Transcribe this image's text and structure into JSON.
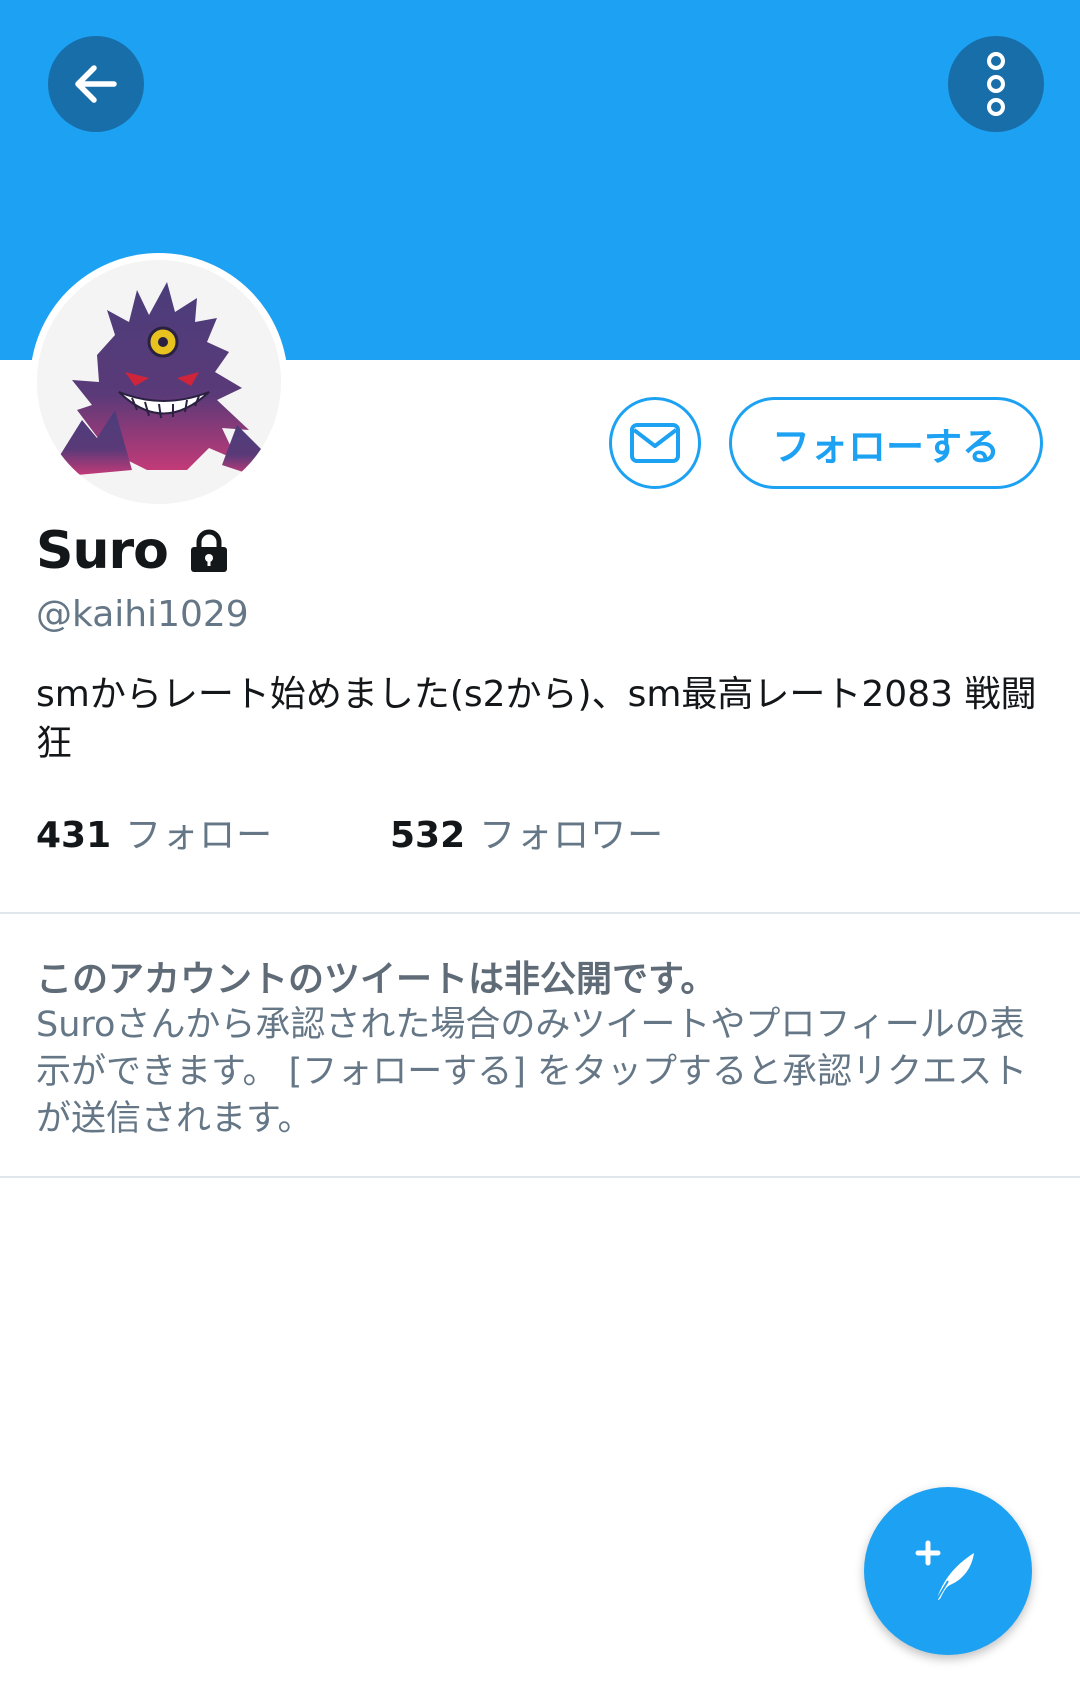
{
  "header": {
    "back_icon": "arrow-left-icon",
    "more_icon": "more-vertical-icon",
    "banner_color": "#1da1f2"
  },
  "profile": {
    "avatar_icon": "gengar-avatar",
    "name": "Suro",
    "protected_icon": "lock-icon",
    "handle": "@kaihi1029",
    "bio": "smからレート始めました(s2から)、sm最高レート2083 戦闘狂"
  },
  "actions": {
    "message_icon": "envelope-icon",
    "follow_label": "フォローする",
    "accent_color": "#1da1f2"
  },
  "stats": {
    "following_count": "431",
    "following_label": "フォロー",
    "followers_count": "532",
    "followers_label": "フォロワー"
  },
  "private_notice": {
    "title": "このアカウントのツイートは非公開です。",
    "body": "Suroさんから承認された場合のみツイートやプロフィールの表示ができます。 [フォローする] をタップすると承認リクエストが送信されます。"
  },
  "fab": {
    "icon": "compose-tweet-icon"
  }
}
